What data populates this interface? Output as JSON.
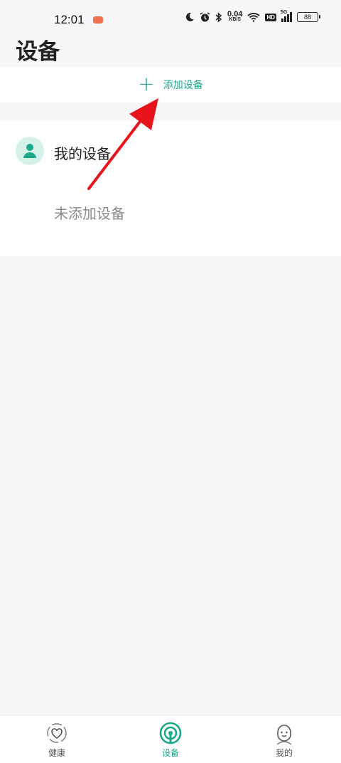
{
  "status_bar": {
    "time": "12:01",
    "speed_value": "0.04",
    "speed_unit": "KB/S",
    "hd": "HD",
    "network": "5G",
    "battery": "88"
  },
  "header": {
    "title": "设备"
  },
  "add_device": {
    "label": "添加设备",
    "icon": "plus-icon"
  },
  "my_devices": {
    "title": "我的设备",
    "empty_text": "未添加设备"
  },
  "tabs": [
    {
      "label": "健康",
      "icon": "health-icon",
      "active": false
    },
    {
      "label": "设备",
      "icon": "device-icon",
      "active": true
    },
    {
      "label": "我的",
      "icon": "profile-icon",
      "active": false
    }
  ],
  "colors": {
    "accent": "#1aa98a",
    "annotation": "#e8141c",
    "background": "#f7f6f8"
  }
}
